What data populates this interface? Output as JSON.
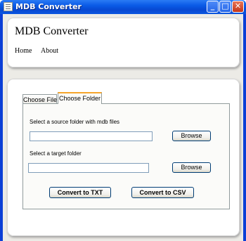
{
  "window": {
    "title": "MDB Converter",
    "minimize_glyph": "_",
    "maximize_glyph": "□",
    "close_glyph": "✕"
  },
  "header": {
    "title": "MDB Converter",
    "nav": [
      {
        "label": "Home"
      },
      {
        "label": "About"
      }
    ]
  },
  "tabs": [
    {
      "label": "Choose File",
      "selected": false
    },
    {
      "label": "Choose Folder",
      "selected": true
    }
  ],
  "folder_panel": {
    "source_label": "Select a source folder with mdb files",
    "source_value": "",
    "source_browse_label": "Browse",
    "target_label": "Select a target folder",
    "target_value": "",
    "target_browse_label": "Browse",
    "convert_txt_label": "Convert to TXT",
    "convert_csv_label": "Convert to CSV"
  },
  "colors": {
    "titlebar": "#0a5ae6",
    "selected_tab_accent": "#f6a52c",
    "client_background": "#ecebe6"
  }
}
